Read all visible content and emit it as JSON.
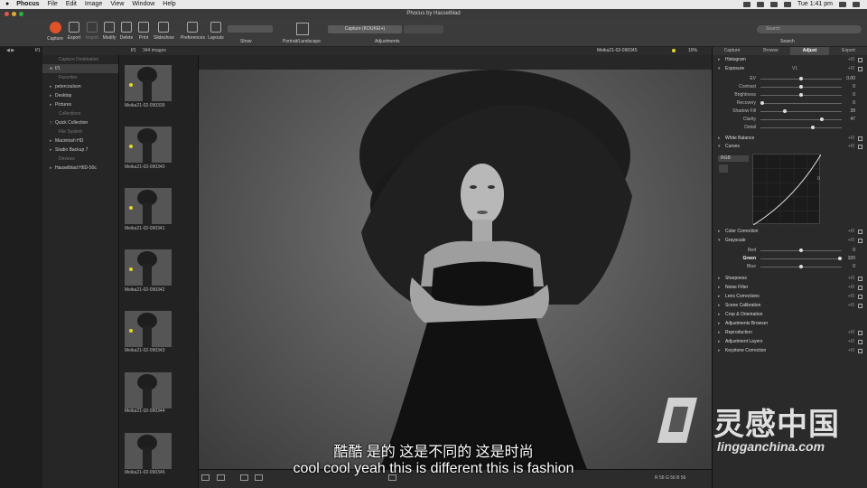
{
  "menubar": {
    "app_name": "Phocus",
    "items": [
      "File",
      "Edit",
      "Image",
      "View",
      "Window",
      "Help"
    ],
    "clock": "Tue 1:41 pm"
  },
  "window": {
    "title": "Phocus by Hasselblad"
  },
  "toolbar": {
    "buttons": [
      "Capture",
      "Export",
      "Import",
      "Modify",
      "Delete",
      "Print",
      "Slideshow",
      "Preferences",
      "Layouts"
    ],
    "show_label": "Show",
    "portrait_label": "Portrait/Landscape",
    "capture_preset": "Capture (KOUKEI+)",
    "adjustments_label": "Adjustments",
    "search_placeholder": "Search",
    "search_label": "Search"
  },
  "subbar": {
    "folder": "f/1",
    "image_count": "344 images",
    "current_file": "Meika21-02-090345",
    "zoom": "15%"
  },
  "sidebar": {
    "capture_destination_header": "Capture Destination",
    "capture_folder": "f/1",
    "favorites_header": "Favorites",
    "favorites": [
      "petercoulson",
      "Desktop",
      "Pictures"
    ],
    "collections_header": "Collections",
    "collections": [
      "Quick Collection"
    ],
    "filesystem_header": "File System",
    "filesystem": [
      "Macintosh HD",
      "Studio Backup 7"
    ],
    "devices_header": "Devices",
    "devices": [
      "Hasselblad H6D-50c"
    ]
  },
  "thumbnails": [
    {
      "label": "Meika21-02-090339"
    },
    {
      "label": "Meika21-02-090340"
    },
    {
      "label": "Meika21-02-090341"
    },
    {
      "label": "Meika21-02-090342"
    },
    {
      "label": "Meika21-02-090343"
    },
    {
      "label": "Meika21-02-090344"
    },
    {
      "label": "Meika21-02-090345"
    }
  ],
  "adjust_panel": {
    "tabs": [
      "Capture",
      "Browse",
      "Adjust",
      "Export"
    ],
    "active_tab": "Adjust",
    "histogram": "Histogram",
    "exposure": {
      "title": "Exposure",
      "preset": "V1",
      "sliders": [
        {
          "label": "EV",
          "value": "0.00",
          "pos": 0.5
        },
        {
          "label": "Contrast",
          "value": "0",
          "pos": 0.5
        },
        {
          "label": "Brightness",
          "value": "0",
          "pos": 0.5
        },
        {
          "label": "Recovery",
          "value": "0",
          "pos": 0.0
        },
        {
          "label": "Shadow Fill",
          "value": "28",
          "pos": 0.28
        },
        {
          "label": "Clarity",
          "value": "47",
          "pos": 0.74
        },
        {
          "label": "Detail",
          "value": "",
          "pos": 0.62
        }
      ]
    },
    "white_balance": "White Balance",
    "curves": {
      "title": "Curves",
      "channel": "RGB",
      "right_value": "0"
    },
    "color_correction": "Color Correction",
    "grayscale": {
      "title": "Grayscale",
      "sliders": [
        {
          "label": "Red",
          "value": "0",
          "pos": 0.5
        },
        {
          "label": "Green",
          "value": "100",
          "pos": 1.0
        },
        {
          "label": "Blue",
          "value": "0",
          "pos": 0.5
        }
      ]
    },
    "sections": [
      "Sharpness",
      "Noise Filter",
      "Lens Corrections",
      "Scene Calibration",
      "Crop & Orientation",
      "Adjustments Browser",
      "Reproduction",
      "Adjustment Layers",
      "Keystone Correction"
    ],
    "pct_label": "+/0"
  },
  "bottom_readout": "R   56   G   56   B   56",
  "subtitles": {
    "chinese": "酷酷 是的 这是不同的 这是时尚",
    "english": "cool cool yeah this is different this is fashion"
  },
  "watermark": {
    "brand_cn": "灵感中国",
    "url": "lingganchina.com"
  },
  "colors": {
    "capture_button": "#e0522a",
    "rating_dot": "#e6d42a",
    "toolbar_bg": "#3b3b3b"
  }
}
